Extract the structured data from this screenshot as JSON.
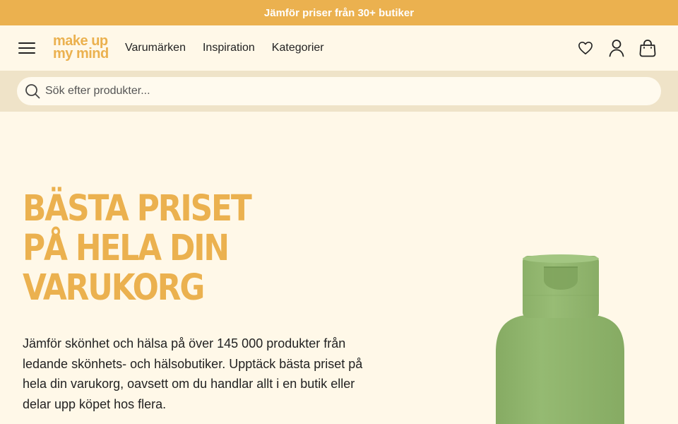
{
  "promo": {
    "text": "Jämför priser från 30+ butiker"
  },
  "header": {
    "logo": {
      "line1": "make up",
      "line2": "my mind"
    },
    "nav": [
      {
        "label": "Varumärken"
      },
      {
        "label": "Inspiration"
      },
      {
        "label": "Kategorier"
      }
    ],
    "icons": [
      "heart-icon",
      "user-icon",
      "bag-icon"
    ]
  },
  "search": {
    "placeholder": "Sök efter produkter...",
    "value": ""
  },
  "hero": {
    "title_lines": [
      "BÄSTA PRISET",
      "PÅ HELA DIN",
      "VARUKORG"
    ],
    "description": "Jämför skönhet och hälsa på över 145 000 produkter från ledande skönhets- och hälsobutiker. Upptäck bästa priset på hela din varukorg, oavsett om du handlar allt i en butik eller delar upp köpet hos flera."
  },
  "colors": {
    "accent": "#ebb14f",
    "background": "#fff8e8",
    "search_band": "#efe3c8",
    "bottle_green": "#8fb46d"
  }
}
